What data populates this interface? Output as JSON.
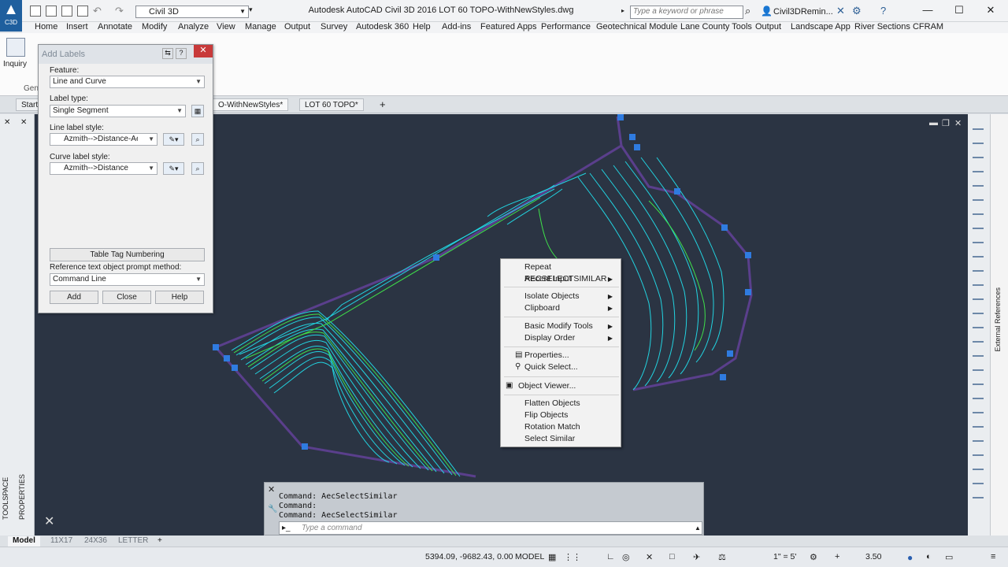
{
  "app": {
    "title": "Autodesk AutoCAD Civil 3D 2016     LOT 60 TOPO-WithNewStyles.dwg",
    "app_button": "C3D",
    "workspace": "Civil 3D"
  },
  "search": {
    "placeholder": "Type a keyword or phrase"
  },
  "user": {
    "name": "Civil3DRemin..."
  },
  "menu": [
    "Home",
    "Insert",
    "Annotate",
    "Modify",
    "Analyze",
    "View",
    "Manage",
    "Output",
    "Survey",
    "Autodesk 360",
    "Help",
    "Add-ins",
    "Featured Apps",
    "Performance",
    "Geotechnical Module",
    "Lane County Tools",
    "Output",
    "Landscape App",
    "River Sections CFRAM"
  ],
  "ribbon": {
    "inquiry_label": "Inquiry",
    "gen_label": "Gen"
  },
  "doc_tabs": {
    "start": "Start",
    "active": "O-WithNewStyles*",
    "second": "LOT 60 TOPO*",
    "add": "+"
  },
  "dialog": {
    "title": "Add Labels",
    "feature_label": "Feature:",
    "feature_value": "Line and Curve",
    "label_type_label": "Label type:",
    "label_type_value": "Single Segment",
    "line_style_label": "Line label style:",
    "line_style_value": "Azmith-->Distance-AeComp",
    "curve_style_label": "Curve label style:",
    "curve_style_value": "Azmith-->Distance",
    "table_tag_button": "Table Tag Numbering",
    "ref_prompt_label": "Reference text object prompt method:",
    "ref_prompt_value": "Command Line",
    "add_button": "Add",
    "close_button": "Close",
    "help_button": "Help"
  },
  "context_menu": {
    "items": [
      {
        "label": "Repeat AECSELECTSIMILAR",
        "sub": false
      },
      {
        "label": "Recent Input",
        "sub": true
      },
      {
        "label": "Isolate Objects",
        "sub": true
      },
      {
        "label": "Clipboard",
        "sub": true
      },
      {
        "label": "Basic Modify Tools",
        "sub": true
      },
      {
        "label": "Display Order",
        "sub": true
      },
      {
        "label": "Properties...",
        "sub": false
      },
      {
        "label": "Quick Select...",
        "sub": false
      },
      {
        "label": "Object Viewer...",
        "sub": false
      },
      {
        "label": "Flatten Objects",
        "sub": false
      },
      {
        "label": "Flip Objects",
        "sub": false
      },
      {
        "label": "Rotation Match",
        "sub": false
      },
      {
        "label": "Select Similar",
        "sub": false
      }
    ]
  },
  "command_line": {
    "history": [
      "Command: AecSelectSimilar",
      "Command:",
      "Command: AecSelectSimilar"
    ],
    "placeholder": "Type a command"
  },
  "left_palette": {
    "toolspace": "TOOLSPACE",
    "properties": "PROPERTIES"
  },
  "right_palette": {
    "external_references": "External References"
  },
  "layout_tabs": [
    "Model",
    "11X17",
    "24X36",
    "LETTER",
    "+"
  ],
  "status": {
    "coords": "5394.09, -9682.43, 0.00",
    "space": "MODEL",
    "scale": "1\" = 5'",
    "zoom": "3.50"
  },
  "colors": {
    "drawing_bg": "#2b3443",
    "contour_cyan": "#22d3e0",
    "contour_green": "#3ee04a",
    "boundary": "#5a3f8c",
    "grip": "#2f7be0"
  }
}
